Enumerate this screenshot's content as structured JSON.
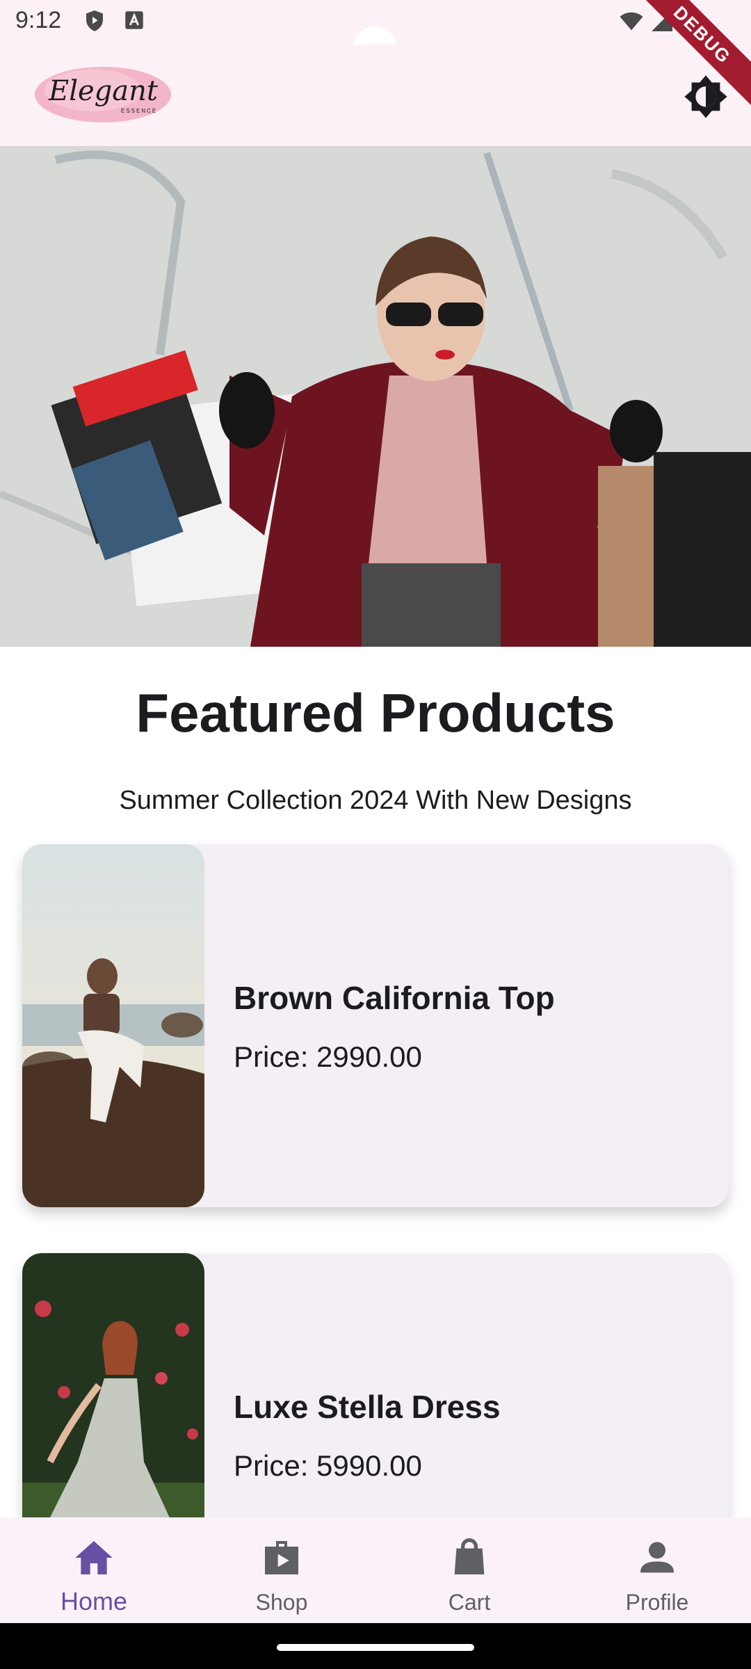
{
  "status_bar": {
    "time": "9:12"
  },
  "app_bar": {
    "logo_text": "Elegant",
    "logo_subtext": "ESSENCE",
    "debug_label": "DEBUG"
  },
  "section": {
    "title": "Featured Products",
    "subtitle": "Summer Collection 2024 With New Designs"
  },
  "products": [
    {
      "name": "Brown California Top",
      "price": "Price: 2990.00"
    },
    {
      "name": "Luxe Stella Dress",
      "price": "Price: 5990.00"
    }
  ],
  "nav": {
    "items": [
      {
        "label": "Home",
        "icon": "home-icon",
        "active": true
      },
      {
        "label": "Shop",
        "icon": "shop-icon",
        "active": false
      },
      {
        "label": "Cart",
        "icon": "cart-icon",
        "active": false
      },
      {
        "label": "Profile",
        "icon": "profile-icon",
        "active": false
      }
    ]
  },
  "colors": {
    "accent": "#6650a4",
    "app_bar_bg": "#fdf1f8",
    "card_bg": "#f4eff4"
  }
}
